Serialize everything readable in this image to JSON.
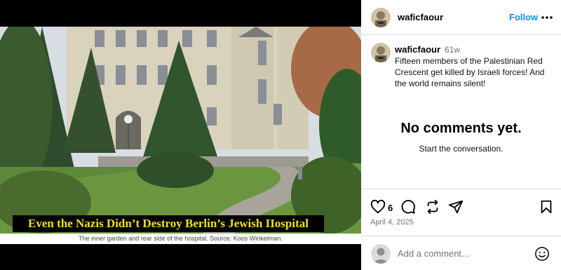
{
  "post": {
    "headline": "Even the Nazis Didn’t Destroy Berlin’s Jewish IIospital",
    "image_caption": "The inner garden and rear side of the hospital. Source: Koos Winkelman."
  },
  "header": {
    "username": "waficfaour",
    "follow_label": "Follow",
    "more_icon": "more-horizontal-icon"
  },
  "caption": {
    "username": "waficfaour",
    "time": "61w",
    "text": "Fifteen members of the Palestinian Red Crescent get killed by Israeli forces! And the world remains silent!"
  },
  "comments": {
    "empty_title": "No comments yet.",
    "empty_subtitle": "Start the conversation."
  },
  "actions": {
    "like_count": "6",
    "date": "April 4, 2025",
    "icons": [
      "heart-icon",
      "comment-icon",
      "repost-icon",
      "share-icon",
      "bookmark-icon"
    ]
  },
  "add_comment": {
    "placeholder": "Add a comment…"
  },
  "colors": {
    "accent": "#0095f6",
    "headline_text": "#f0e020"
  }
}
